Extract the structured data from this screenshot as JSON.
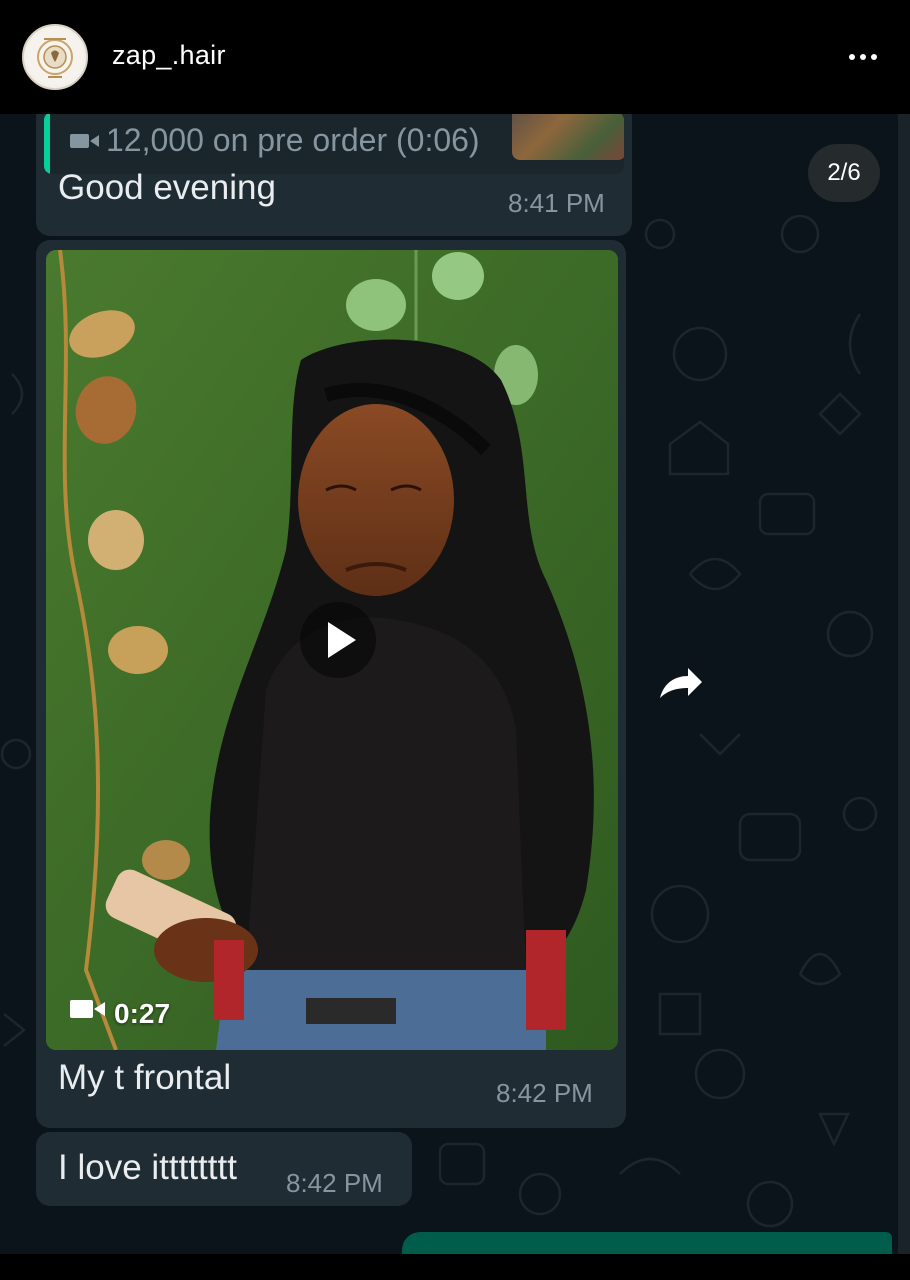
{
  "header": {
    "username": "zap_.hair",
    "avatar_icon": "brand-logo-avatar",
    "more_icon": "more-horizontal-icon"
  },
  "story": {
    "counter": "2/6"
  },
  "chat": {
    "messages": [
      {
        "type": "reply",
        "quoted_text": "12,000 on pre order (0:06)",
        "quoted_icon": "video-camera-icon",
        "text": "Good evening",
        "time": "8:41 PM"
      },
      {
        "type": "video",
        "duration": "0:27",
        "caption": "My t frontal",
        "time": "8:42 PM",
        "icons": [
          "play-icon",
          "video-camera-icon",
          "forward-icon"
        ]
      },
      {
        "type": "text",
        "text": "I love itttttttt",
        "time": "8:42 PM"
      }
    ]
  },
  "colors": {
    "chat_bg": "#0b141a",
    "incoming_bubble": "#1f2c34",
    "outgoing_bubble": "#005c4b",
    "quote_accent": "#06cf9c",
    "timestamp": "#8696a0",
    "text": "#e9edef"
  }
}
